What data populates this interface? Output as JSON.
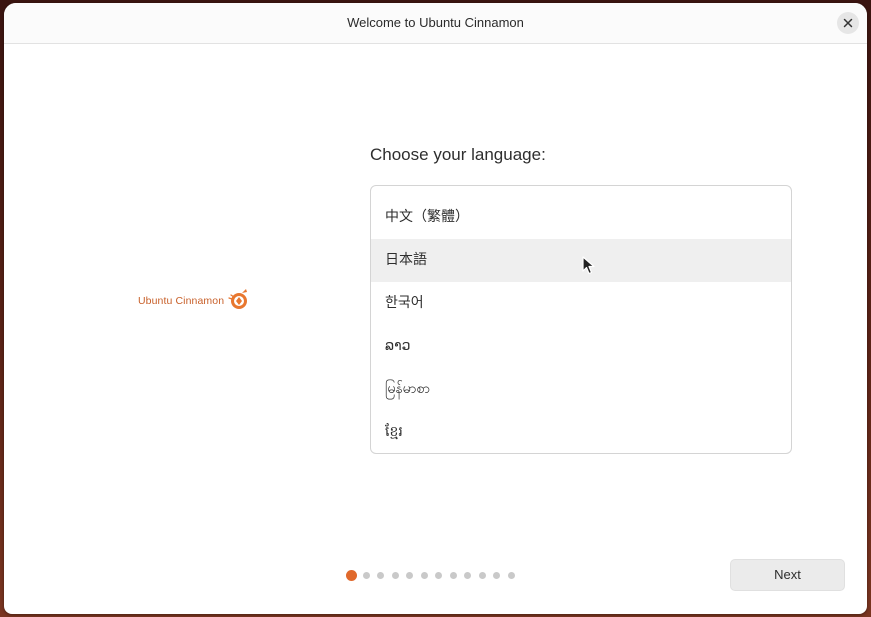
{
  "window": {
    "title": "Welcome to Ubuntu Cinnamon",
    "close_icon": "close-icon"
  },
  "logo": {
    "text": "Ubuntu Cinnamon",
    "icon": "cinnamon-logo-icon",
    "color": "#c8602a"
  },
  "main": {
    "heading": "Choose your language:",
    "languages": [
      {
        "label": "中文（繁體）"
      },
      {
        "label": "日本語",
        "hovered": true
      },
      {
        "label": "한국어"
      },
      {
        "label": "ລາວ"
      },
      {
        "label": "မြန်မာစာ"
      },
      {
        "label": "ខ្មែរ"
      }
    ]
  },
  "footer": {
    "steps_total": 12,
    "current_step": 1,
    "accent_color": "#e0692c",
    "next_label": "Next"
  }
}
